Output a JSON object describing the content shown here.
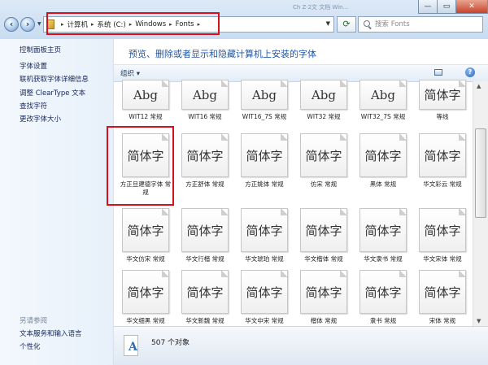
{
  "window": {
    "min_label": "—",
    "max_label": "▭",
    "close_label": "✕",
    "background_tab_text": "Ch Z·2文 文档 Win..."
  },
  "address": {
    "crumbs": [
      "计算机",
      "系统 (C:)",
      "Windows",
      "Fonts"
    ],
    "separator": "▸",
    "search_placeholder": "搜索 Fonts"
  },
  "sidebar": {
    "links": [
      "控制面板主页",
      "字体设置",
      "联机获取字体详细信息",
      "调整 ClearType 文本",
      "查找字符",
      "更改字体大小"
    ],
    "see_also_heading": "另请参阅",
    "see_also_links": [
      "文本服务和输入语言",
      "个性化"
    ]
  },
  "main": {
    "heading": "预览、删除或者显示和隐藏计算机上安装的字体",
    "toolbar": {
      "organize_label": "组织 ▾",
      "help_label": "?"
    }
  },
  "fonts": [
    {
      "label": "WIT12 常规",
      "sample": "Abg"
    },
    {
      "label": "WIT16 常规",
      "sample": "Abg"
    },
    {
      "label": "WIT16_7S 常规",
      "sample": "Abg"
    },
    {
      "label": "WIT32 常规",
      "sample": "Abg"
    },
    {
      "label": "WIT32_7S 常规",
      "sample": "Abg"
    },
    {
      "label": "等线",
      "sample": "简体字"
    },
    {
      "label": "方正旦建德字体 常规",
      "sample": "简体字"
    },
    {
      "label": "方正舒体 常规",
      "sample": "简体字"
    },
    {
      "label": "方正姚体 常规",
      "sample": "简体字"
    },
    {
      "label": "仿宋 常规",
      "sample": "简体字"
    },
    {
      "label": "黑体 常规",
      "sample": "简体字"
    },
    {
      "label": "华文彩云 常规",
      "sample": "简体字"
    },
    {
      "label": "华文仿宋 常规",
      "sample": "简体字"
    },
    {
      "label": "华文行楷 常规",
      "sample": "简体字"
    },
    {
      "label": "华文琥珀 常规",
      "sample": "简体字"
    },
    {
      "label": "华文楷体 常规",
      "sample": "简体字"
    },
    {
      "label": "华文隶书 常规",
      "sample": "简体字"
    },
    {
      "label": "华文宋体 常规",
      "sample": "简体字"
    },
    {
      "label": "华文细黑 常规",
      "sample": "简体字"
    },
    {
      "label": "华文新魏 常规",
      "sample": "简体字"
    },
    {
      "label": "华文中宋 常规",
      "sample": "简体字"
    },
    {
      "label": "楷体 常规",
      "sample": "简体字"
    },
    {
      "label": "隶书 常规",
      "sample": "简体字"
    },
    {
      "label": "宋体 常规",
      "sample": "简体字"
    }
  ],
  "details": {
    "count_text": "507 个对象"
  }
}
